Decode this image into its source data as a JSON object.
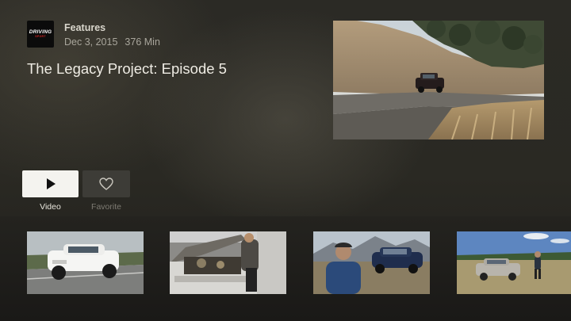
{
  "header": {
    "category": "Features",
    "date": "Dec 3, 2015",
    "duration": "376 Min",
    "logo_line1": "DRIVING",
    "logo_line2": "SPORT"
  },
  "title": "The Legacy Project: Episode 5",
  "actions": {
    "video_label": "Video",
    "favorite_label": "Favorite"
  },
  "colors": {
    "background": "#2a2923",
    "button_active": "#f4f3ef",
    "button_inactive": "#3d3c37",
    "logo_accent": "#d32020"
  },
  "icons": {
    "play": "play-icon",
    "favorite": "heart-icon"
  },
  "thumbnails": [
    {
      "subject": "white sedan on race track"
    },
    {
      "subject": "mechanic working on open engine bay"
    },
    {
      "subject": "man in blue jacket beside blue hatchback"
    },
    {
      "subject": "man standing beside silver sedan in field"
    }
  ]
}
